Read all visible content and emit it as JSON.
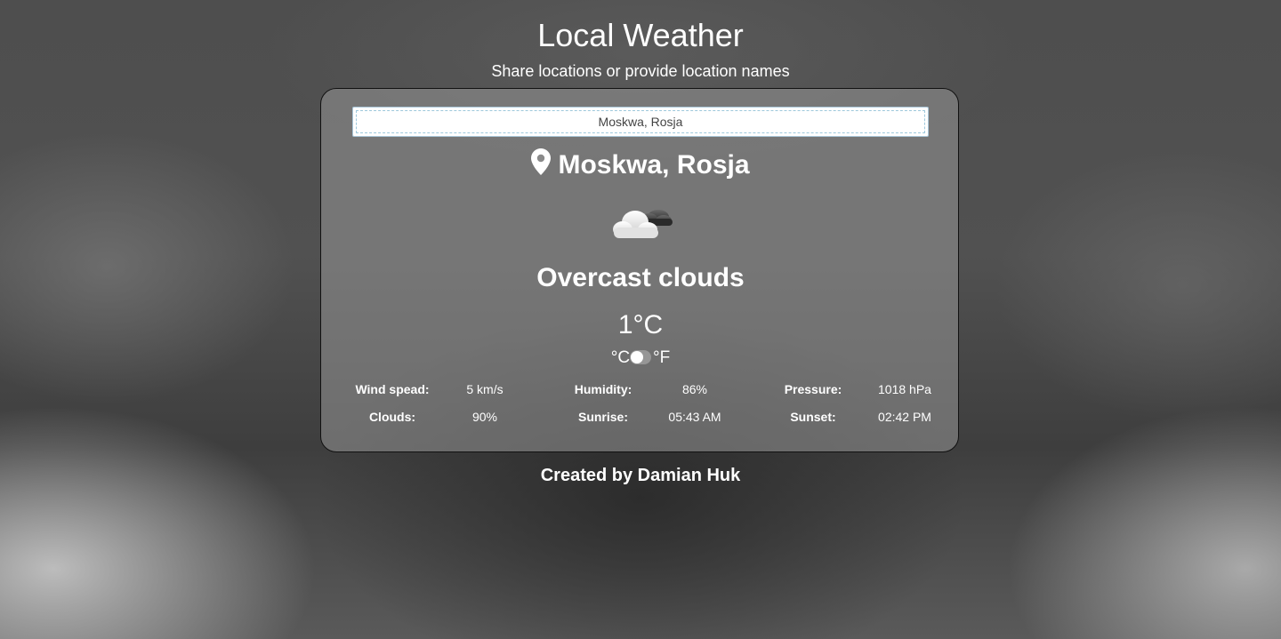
{
  "header": {
    "title": "Local Weather",
    "subtitle": "Share locations or provide location names"
  },
  "search": {
    "value": "Moskwa, Rosja"
  },
  "location": {
    "name": "Moskwa, Rosja",
    "icon": "map-pin-icon"
  },
  "weather": {
    "icon": "overcast-clouds-icon",
    "description": "Overcast clouds",
    "temperature": "1°C",
    "unit_celsius": "°C",
    "unit_fahrenheit": "°F",
    "unit_selected": "°C"
  },
  "details": {
    "wind_label": "Wind spead:",
    "wind_value": "5 km/s",
    "humidity_label": "Humidity:",
    "humidity_value": "86%",
    "pressure_label": "Pressure:",
    "pressure_value": "1018 hPa",
    "clouds_label": "Clouds:",
    "clouds_value": "90%",
    "sunrise_label": "Sunrise:",
    "sunrise_value": "05:43 AM",
    "sunset_label": "Sunset:",
    "sunset_value": "02:42 PM"
  },
  "footer": {
    "credit": "Created by Damian Huk"
  },
  "colors": {
    "text": "#ffffff",
    "card_border": "#111111",
    "input_border": "#a9c6d8"
  }
}
